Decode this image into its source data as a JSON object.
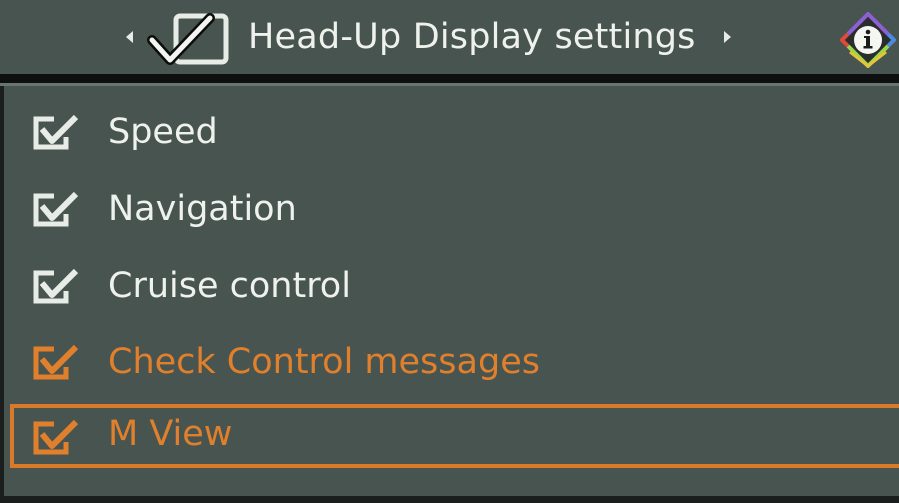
{
  "header": {
    "title": "Head-Up Display settings",
    "left_arrow_icon": "triangle-left",
    "right_arrow_icon": "triangle-right",
    "hud_icon": "hud-check-icon",
    "info_icon": "info-diamond-icon"
  },
  "menu": {
    "items": [
      {
        "label": "Speed",
        "checked": true,
        "highlighted": false,
        "selected": false
      },
      {
        "label": "Navigation",
        "checked": true,
        "highlighted": false,
        "selected": false
      },
      {
        "label": "Cruise control",
        "checked": true,
        "highlighted": false,
        "selected": false
      },
      {
        "label": "Check Control messages",
        "checked": true,
        "highlighted": true,
        "selected": false
      },
      {
        "label": "M View",
        "checked": true,
        "highlighted": true,
        "selected": true
      }
    ]
  },
  "colors": {
    "background": "#485450",
    "text": "#eef1ec",
    "accent": "#e1802c"
  }
}
